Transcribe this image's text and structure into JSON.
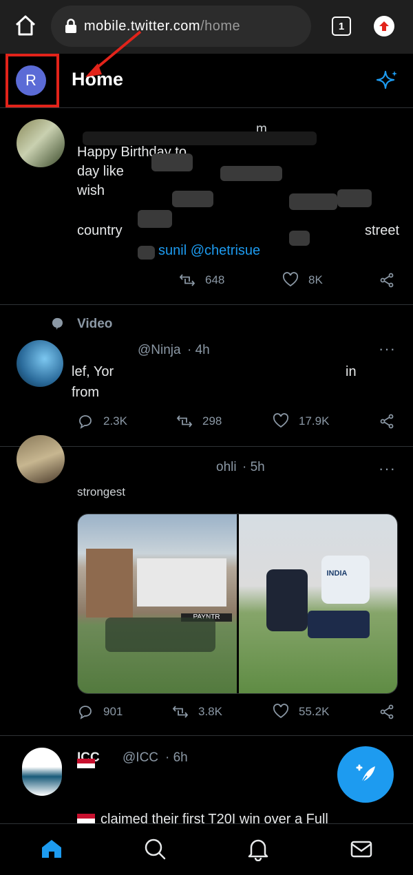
{
  "browser": {
    "url_host": "mobile.twitter.com",
    "url_path": "/home",
    "tab_count": "1"
  },
  "header": {
    "avatar_letter": "R",
    "title": "Home"
  },
  "tweets": [
    {
      "meta_top": "m",
      "text_lines": [
        "Happy Birthday to",
        "day like",
        "wish",
        "",
        "country",
        ""
      ],
      "mention": "@chetrisue",
      "mention_prefix": "sunil",
      "retweets": "648",
      "likes": "8K"
    },
    {
      "context": "Video",
      "handle": "@Ninja",
      "time": "· 4h",
      "text_line1": "lef, Yor",
      "text_line2": "from",
      "text_right": "in",
      "replies": "2.3K",
      "retweets": "298",
      "likes": "17.9K"
    },
    {
      "handle": "ohli",
      "time": "· 5h",
      "text_line1": "strongest",
      "replies": "901",
      "retweets": "3.8K",
      "likes": "55.2K",
      "media_banner": "PAYNTR",
      "jersey_text": "INDIA"
    },
    {
      "name": "ICC",
      "handle": "@ICC",
      "time": "· 6h",
      "text_line1": "claimed their first T20I win over a Full"
    }
  ],
  "colors": {
    "accent": "#1d9bf0",
    "annotation_red": "#e2231a"
  },
  "icons": {
    "browser_home": "home-outline-icon",
    "lock": "lock-icon",
    "tabs": "tab-switcher-icon",
    "update": "update-arrow-icon",
    "sparkle": "sparkle-icon",
    "reply": "reply-icon",
    "retweet": "retweet-icon",
    "like": "heart-icon",
    "share": "share-icon",
    "compose": "compose-feather-icon",
    "nav_home": "home-icon",
    "nav_search": "search-icon",
    "nav_notifications": "bell-icon",
    "nav_messages": "mail-icon"
  }
}
